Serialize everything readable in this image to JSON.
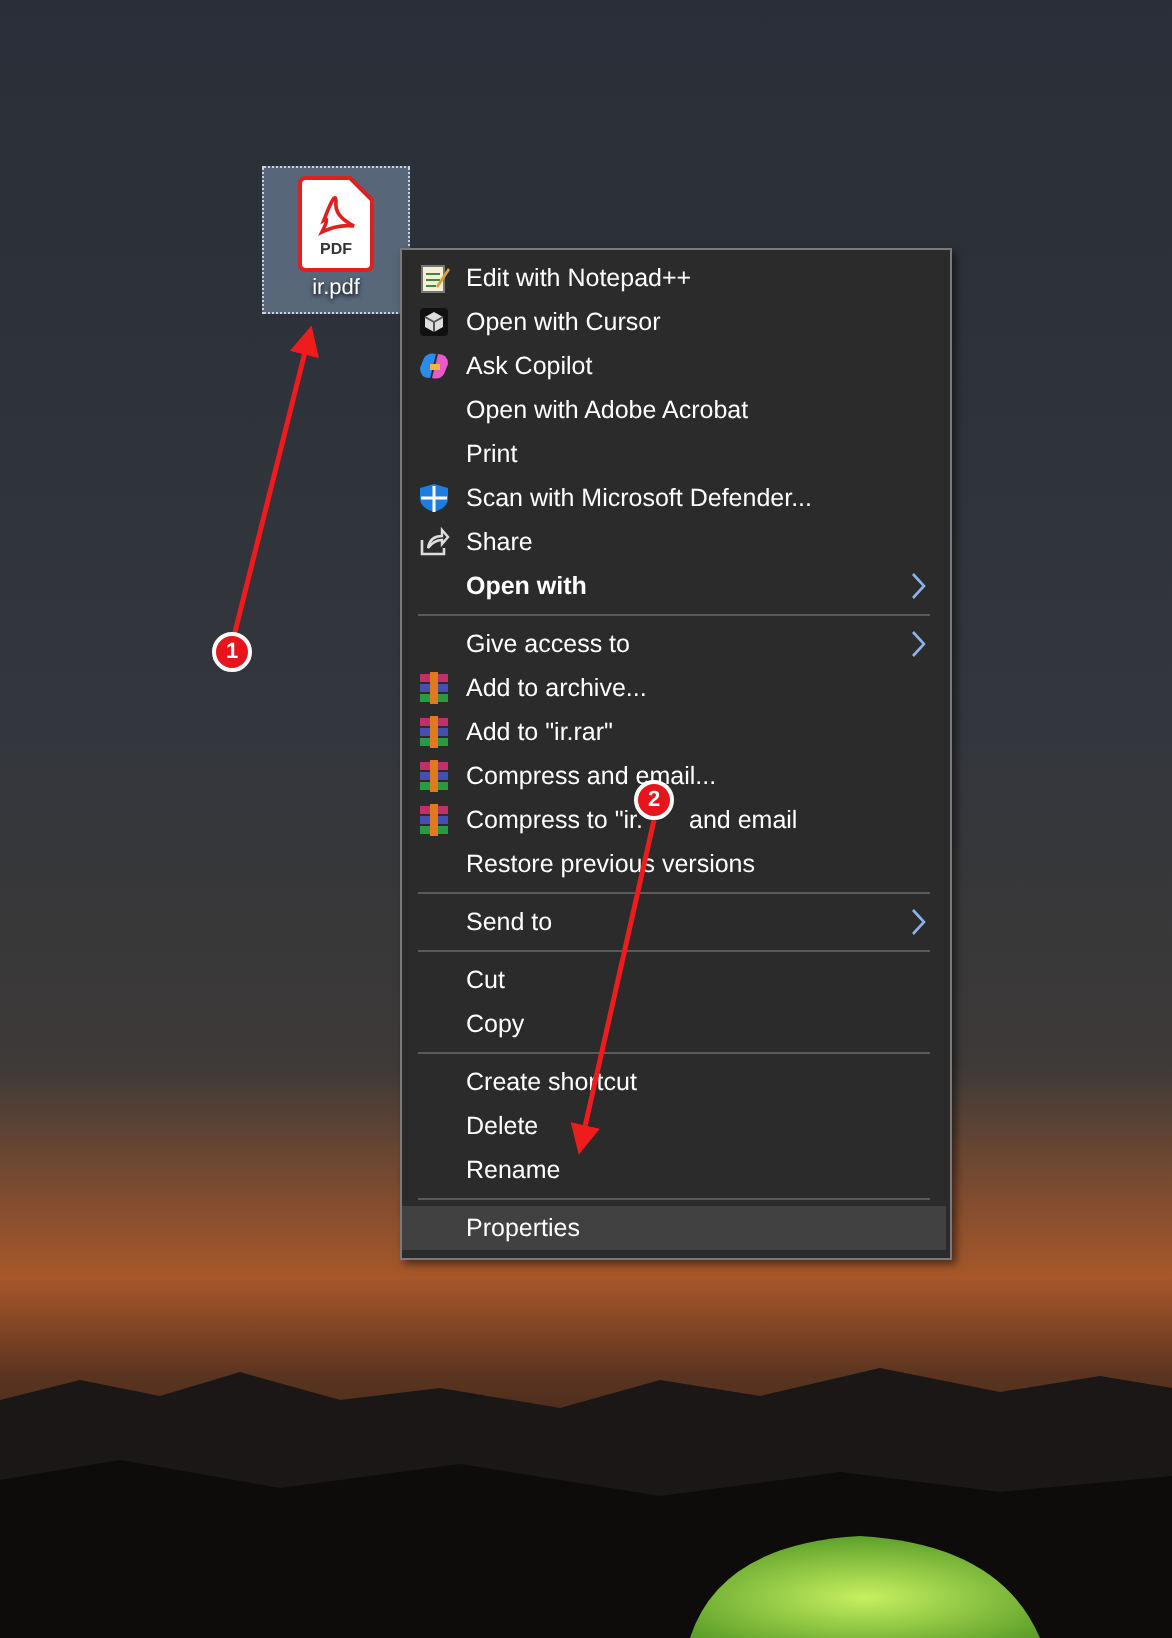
{
  "desktop_icon": {
    "type_text": "PDF",
    "label": "ir.pdf",
    "selected": true
  },
  "context_menu": {
    "groups": [
      [
        {
          "label": "Edit with Notepad++",
          "kind": "notepad",
          "bold": false,
          "submenu": false,
          "selected": false
        },
        {
          "label": "Open with Cursor",
          "kind": "cursor",
          "bold": false,
          "submenu": false,
          "selected": false
        },
        {
          "label": "Ask Copilot",
          "kind": "copilot",
          "bold": false,
          "submenu": false,
          "selected": false
        },
        {
          "label": "Open with Adobe Acrobat",
          "kind": "plain",
          "bold": false,
          "submenu": false,
          "selected": false
        },
        {
          "label": "Print",
          "kind": "plain",
          "bold": false,
          "submenu": false,
          "selected": false
        },
        {
          "label": "Scan with Microsoft Defender...",
          "kind": "defender",
          "bold": false,
          "submenu": false,
          "selected": false
        },
        {
          "label": "Share",
          "kind": "share",
          "bold": false,
          "submenu": false,
          "selected": false
        },
        {
          "label": "Open with",
          "kind": "plain",
          "bold": true,
          "submenu": true,
          "selected": false
        }
      ],
      [
        {
          "label": "Give access to",
          "kind": "plain",
          "bold": false,
          "submenu": true,
          "selected": false
        },
        {
          "label": "Add to archive...",
          "kind": "winrar",
          "bold": false,
          "submenu": false,
          "selected": false
        },
        {
          "label": "Add to \"ir.rar\"",
          "kind": "winrar",
          "bold": false,
          "submenu": false,
          "selected": false
        },
        {
          "label": "Compress and email...",
          "kind": "winrar",
          "bold": false,
          "submenu": false,
          "selected": false
        },
        {
          "label": "Compress to \"ir.",
          "label_tail": "and email",
          "kind": "winrar",
          "bold": false,
          "submenu": false,
          "selected": false
        },
        {
          "label": "Restore previous versions",
          "kind": "plain",
          "bold": false,
          "submenu": false,
          "selected": false
        }
      ],
      [
        {
          "label": "Send to",
          "kind": "plain",
          "bold": false,
          "submenu": true,
          "selected": false
        }
      ],
      [
        {
          "label": "Cut",
          "kind": "plain",
          "bold": false,
          "submenu": false,
          "selected": false
        },
        {
          "label": "Copy",
          "kind": "plain",
          "bold": false,
          "submenu": false,
          "selected": false
        }
      ],
      [
        {
          "label": "Create shortcut",
          "kind": "plain",
          "bold": false,
          "submenu": false,
          "selected": false
        },
        {
          "label": "Delete",
          "kind": "plain",
          "bold": false,
          "submenu": false,
          "selected": false
        },
        {
          "label": "Rename",
          "kind": "plain",
          "bold": false,
          "submenu": false,
          "selected": false
        }
      ],
      [
        {
          "label": "Properties",
          "kind": "plain",
          "bold": false,
          "submenu": false,
          "selected": true
        }
      ]
    ]
  },
  "annotations": [
    {
      "label": "1"
    },
    {
      "label": "2"
    }
  ]
}
